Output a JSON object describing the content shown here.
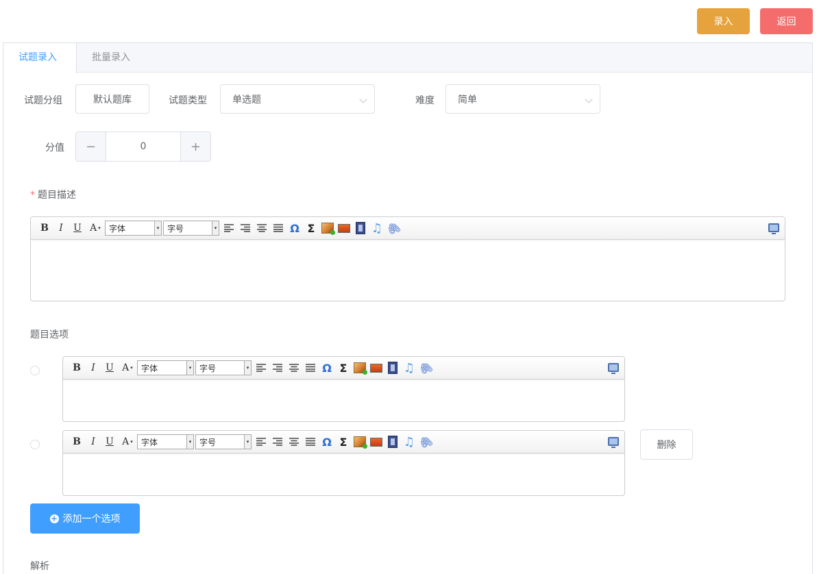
{
  "header": {
    "submit_label": "录入",
    "back_label": "返回"
  },
  "tabs": [
    {
      "label": "试题录入",
      "active": true
    },
    {
      "label": "批量录入",
      "active": false
    }
  ],
  "form": {
    "group_label": "试题分组",
    "group_button": "默认题库",
    "type_label": "试题类型",
    "type_value": "单选题",
    "difficulty_label": "难度",
    "difficulty_value": "简单",
    "score_label": "分值",
    "score_value": "0",
    "score_minus": "−",
    "score_plus": "+",
    "description_required_mark": "*",
    "description_label": "题目描述",
    "options_label": "题目选项",
    "delete_label": "删除",
    "add_option_label": "添加一个选项",
    "analysis_label": "解析"
  },
  "editor_toolbar": {
    "bold": "B",
    "italic": "I",
    "underline": "U",
    "font_color": "A",
    "font_family": "字体",
    "font_size": "字号",
    "omega": "Ω",
    "sigma": "Σ",
    "music": "♫",
    "clip": "🖇",
    "dropdown_caret": "▾"
  },
  "colors": {
    "submit": "#e6a23c",
    "back": "#f56c6c",
    "primary": "#409eff"
  }
}
